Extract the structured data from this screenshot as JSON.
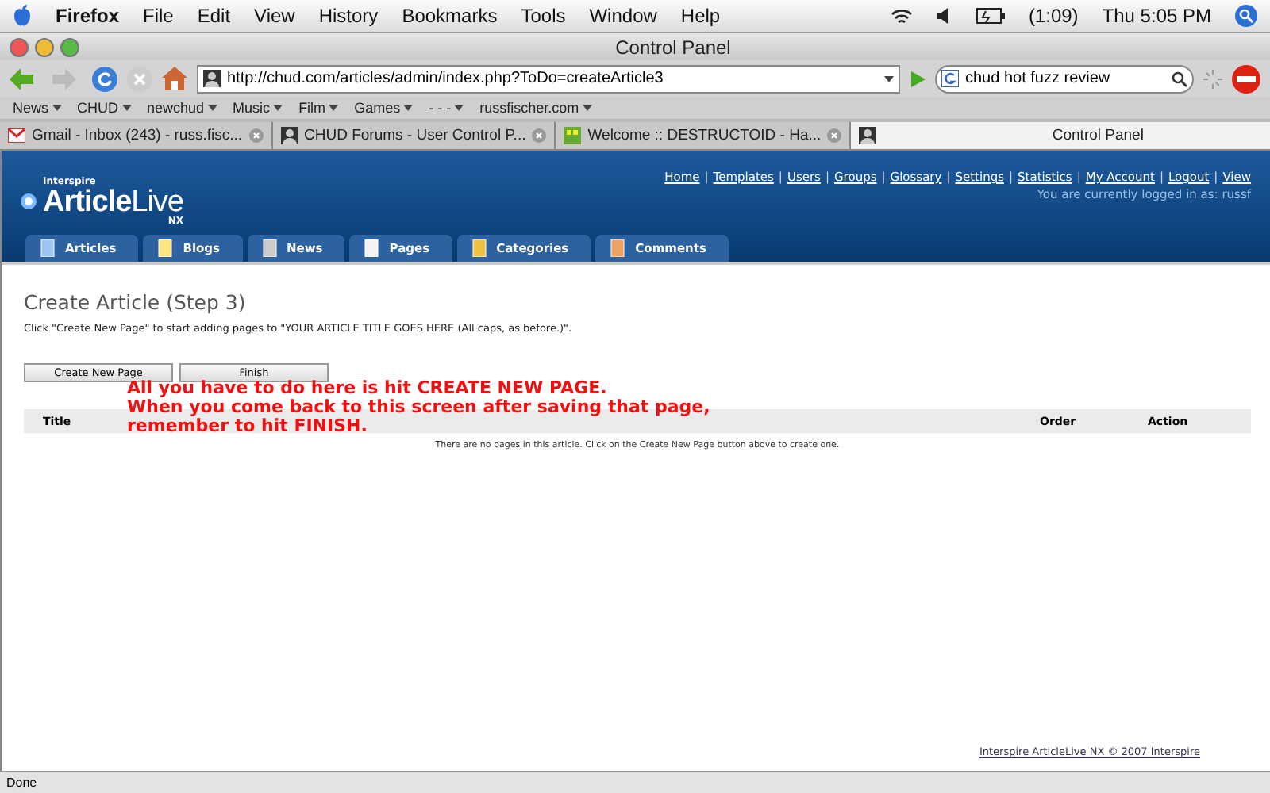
{
  "menubar": {
    "app": "Firefox",
    "menus": [
      "File",
      "Edit",
      "View",
      "History",
      "Bookmarks",
      "Tools",
      "Window",
      "Help"
    ],
    "battery": "(1:09)",
    "clock": "Thu 5:05 PM"
  },
  "window": {
    "title": "Control Panel"
  },
  "toolbar": {
    "url": "http://chud.com/articles/admin/index.php?ToDo=createArticle3",
    "search": "chud hot fuzz review"
  },
  "bookmarks": [
    {
      "label": "News"
    },
    {
      "label": "CHUD"
    },
    {
      "label": "newchud"
    },
    {
      "label": "Music"
    },
    {
      "label": "Film"
    },
    {
      "label": "Games"
    },
    {
      "label": "- - -"
    },
    {
      "label": "russfischer.com"
    }
  ],
  "tabs": [
    {
      "label": "Gmail - Inbox (243) - russ.fisc...",
      "selected": false
    },
    {
      "label": "CHUD Forums - User Control P...",
      "selected": false
    },
    {
      "label": "Welcome :: DESTRUCTOID - Ha...",
      "selected": false
    },
    {
      "label": "Control Panel",
      "selected": true
    }
  ],
  "header": {
    "brand_small": "Interspire",
    "brand": "**Article**Live",
    "brand_suffix": "NX",
    "separator": "|",
    "links": [
      "Home",
      "Templates",
      "Users",
      "Groups",
      "Glossary",
      "Settings",
      "Statistics",
      "My Account",
      "Logout",
      "View"
    ],
    "login_note": "You are currently logged in as: russf"
  },
  "nav_tabs": [
    {
      "label": "Articles"
    },
    {
      "label": "Blogs"
    },
    {
      "label": "News"
    },
    {
      "label": "Pages"
    },
    {
      "label": "Categories"
    },
    {
      "label": "Comments"
    }
  ],
  "content": {
    "heading": "Create Article (Step 3)",
    "intro": "Click \"Create New Page\" to start adding pages to \"YOUR ARTICLE TITLE GOES HERE (All caps, as before.)\".",
    "buttons": [
      "Create New Page",
      "Finish"
    ],
    "table": {
      "columns": [
        "Title",
        "Order",
        "Action"
      ],
      "empty_message": "There are no pages in this article. Click on the Create New Page button above to create one."
    },
    "annotation": [
      "All you have to do here is hit CREATE NEW PAGE.",
      "When you come back to this screen after saving that page,",
      "remember to hit FINISH."
    ]
  },
  "footer": {
    "copyright": "Interspire ArticleLive NX © 2007 Interspire"
  },
  "status_bar": {
    "text": "Done"
  }
}
